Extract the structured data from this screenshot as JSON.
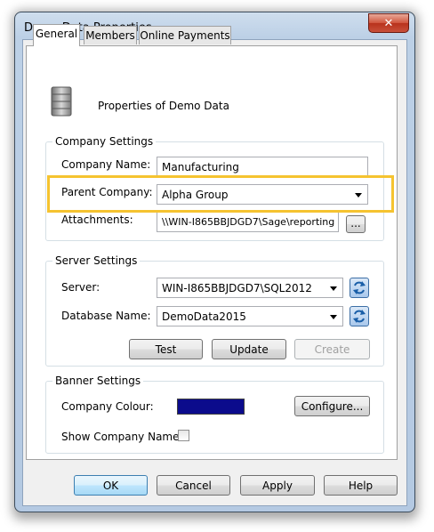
{
  "window": {
    "title": "Demo Data Properties",
    "close_glyph": "✕"
  },
  "tabs": [
    {
      "label": "General",
      "active": true
    },
    {
      "label": "Members",
      "active": false
    },
    {
      "label": "Online Payments",
      "active": false
    }
  ],
  "header": {
    "icon": "database-icon",
    "text": "Properties of Demo Data"
  },
  "company_settings": {
    "title": "Company Settings",
    "company_name_label": "Company Name:",
    "company_name_value": "Manufacturing",
    "parent_company_label": "Parent Company:",
    "parent_company_value": "Alpha Group",
    "attachments_label": "Attachments:",
    "attachments_value": "\\\\WIN-I865BBJDGD7\\Sage\\reporting",
    "browse_label": "..."
  },
  "server_settings": {
    "title": "Server Settings",
    "server_label": "Server:",
    "server_value": "WIN-I865BBJDGD7\\SQL2012",
    "database_label": "Database Name:",
    "database_value": "DemoData2015",
    "test_label": "Test",
    "update_label": "Update",
    "create_label": "Create"
  },
  "banner_settings": {
    "title": "Banner Settings",
    "colour_label": "Company Colour:",
    "colour_value": "#0b0b8c",
    "configure_label": "Configure...",
    "show_name_label": "Show Company Name",
    "show_name_checked": false
  },
  "footer": {
    "ok_label": "OK",
    "cancel_label": "Cancel",
    "apply_label": "Apply",
    "help_label": "Help"
  },
  "colors": {
    "highlight": "#f5c330"
  }
}
